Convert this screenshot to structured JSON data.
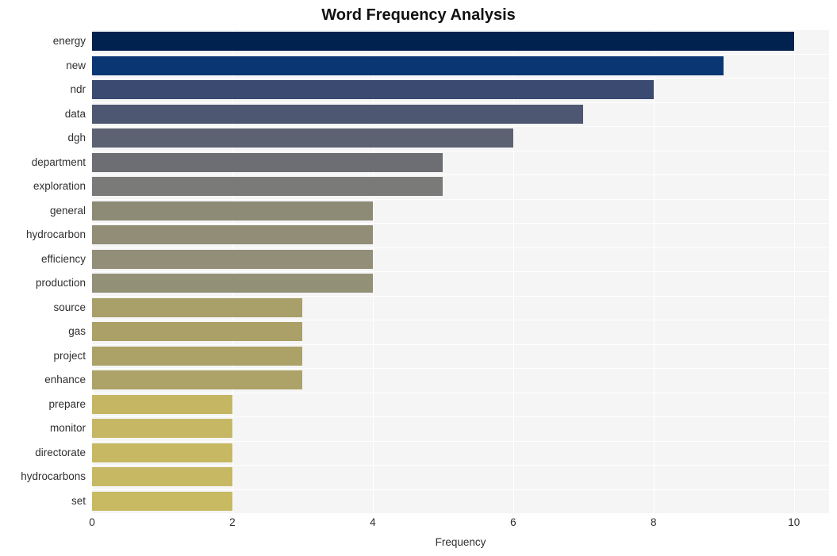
{
  "chart_data": {
    "type": "bar",
    "orientation": "horizontal",
    "title": "Word Frequency Analysis",
    "xlabel": "Frequency",
    "ylabel": "",
    "xlim": [
      0,
      10.5
    ],
    "xticks": [
      0,
      2,
      4,
      6,
      8,
      10
    ],
    "xticklabels": [
      "0",
      "2",
      "4",
      "6",
      "8",
      "10"
    ],
    "grid": true,
    "legend": null,
    "categories": [
      "energy",
      "new",
      "ndr",
      "data",
      "dgh",
      "department",
      "exploration",
      "general",
      "hydrocarbon",
      "efficiency",
      "production",
      "source",
      "gas",
      "project",
      "enhance",
      "prepare",
      "monitor",
      "directorate",
      "hydrocarbons",
      "set"
    ],
    "values": [
      10,
      9,
      8,
      7,
      6,
      5,
      5,
      4,
      4,
      4,
      4,
      3,
      3,
      3,
      3,
      2,
      2,
      2,
      2,
      2
    ],
    "colors": [
      "#01224f",
      "#0b3674",
      "#3a4a71",
      "#4e5771",
      "#5c6272",
      "#6c6e74",
      "#7a7a78",
      "#8d8a76",
      "#918d76",
      "#928e77",
      "#939078",
      "#a99f69",
      "#aba067",
      "#aca167",
      "#ada267",
      "#c5b664",
      "#c6b764",
      "#c7b864",
      "#c7b863",
      "#c8b963"
    ],
    "plot_background": "#f5f5f6",
    "gridline_color": "#ffffff",
    "page_background": "#ffffff"
  }
}
